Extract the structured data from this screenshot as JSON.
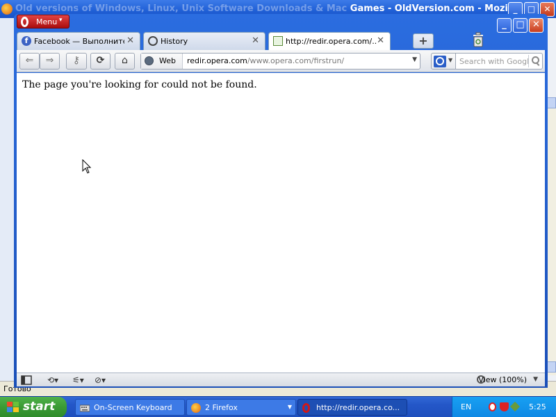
{
  "background_window": {
    "title": "Old versions of Windows, Linux, Unix Software Downloads & Mac Games - OldVersion.com - Mozilla ...",
    "visible_title": "Games - OldVersion.com - Mozilla ...",
    "status_text": "Готово",
    "min_glyph": "_",
    "max_glyph": "□",
    "close_glyph": "✕"
  },
  "opera": {
    "menu_label": "Menu",
    "tabs": [
      {
        "label": "Facebook — Выполните...",
        "icon": "facebook-icon",
        "active": false
      },
      {
        "label": "History",
        "icon": "history-icon",
        "active": false
      },
      {
        "label": "http://redir.opera.com/...",
        "icon": "page-icon",
        "active": true
      }
    ],
    "tab_close_glyph": "✕",
    "new_tab_glyph": "+",
    "toolbar": {
      "back_glyph": "⇐",
      "forward_glyph": "⇒",
      "key_glyph": "⚷",
      "reload_glyph": "⟳",
      "home_glyph": "⌂",
      "web_label": "Web",
      "url_host": "redir.opera.com",
      "url_path": "/www.opera.com/firstrun/",
      "search_placeholder": "Search with Google"
    },
    "content": {
      "message": "The page you're looking for could not be found."
    },
    "status": {
      "zoom_label": "View (100%)"
    },
    "window_controls": {
      "minimize": "_",
      "maximize": "□",
      "close": "✕"
    }
  },
  "taskbar": {
    "start_label": "start",
    "tasks": [
      {
        "label": "On-Screen Keyboard",
        "icon": "keyboard-icon",
        "active": false
      },
      {
        "label": "2 Firefox",
        "icon": "firefox-icon",
        "active": false,
        "has_group": true
      },
      {
        "label": "http://redir.opera.co...",
        "icon": "opera-icon",
        "active": true
      }
    ],
    "language": "EN",
    "clock": "5:25"
  },
  "colors": {
    "xp_blue": "#2457c8",
    "opera_red": "#c41a1a",
    "start_green": "#3a9a34"
  }
}
